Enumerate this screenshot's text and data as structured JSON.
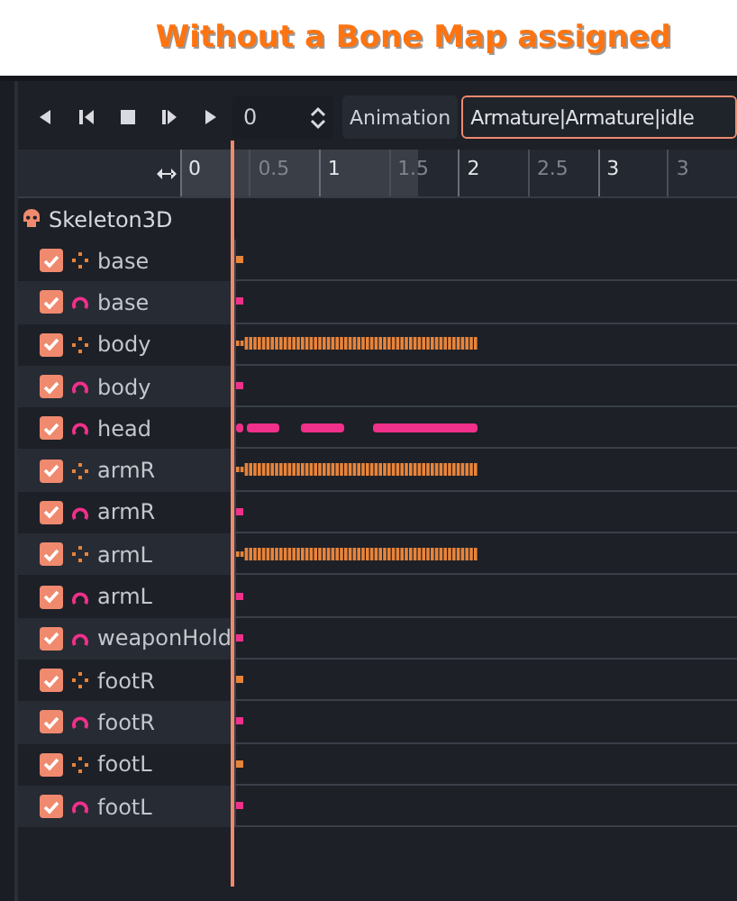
{
  "title": "Without a Bone Map assigned",
  "toolbar": {
    "time": "0",
    "animation_label": "Animation",
    "animation": "Armature|Armature|idle"
  },
  "ruler": [
    "0",
    "0.5",
    "1",
    "1.5",
    "2",
    "2.5",
    "3",
    "3"
  ],
  "tree": {
    "root": "Skeleton3D",
    "tracks": [
      {
        "name": "base",
        "kind": "position",
        "checked": true,
        "animated": false
      },
      {
        "name": "base",
        "kind": "rotation",
        "checked": true,
        "animated": false
      },
      {
        "name": "body",
        "kind": "position",
        "checked": true,
        "animated": true
      },
      {
        "name": "body",
        "kind": "rotation",
        "checked": true,
        "animated": false
      },
      {
        "name": "head",
        "kind": "rotation",
        "checked": true,
        "animated": true
      },
      {
        "name": "armR",
        "kind": "position",
        "checked": true,
        "animated": true
      },
      {
        "name": "armR",
        "kind": "rotation",
        "checked": true,
        "animated": false
      },
      {
        "name": "armL",
        "kind": "position",
        "checked": true,
        "animated": true
      },
      {
        "name": "armL",
        "kind": "rotation",
        "checked": true,
        "animated": false
      },
      {
        "name": "weaponHold",
        "kind": "rotation",
        "checked": true,
        "animated": false
      },
      {
        "name": "footR",
        "kind": "position",
        "checked": true,
        "animated": false
      },
      {
        "name": "footR",
        "kind": "rotation",
        "checked": true,
        "animated": false
      },
      {
        "name": "footL",
        "kind": "position",
        "checked": true,
        "animated": false
      },
      {
        "name": "footL",
        "kind": "rotation",
        "checked": true,
        "animated": false
      }
    ]
  }
}
